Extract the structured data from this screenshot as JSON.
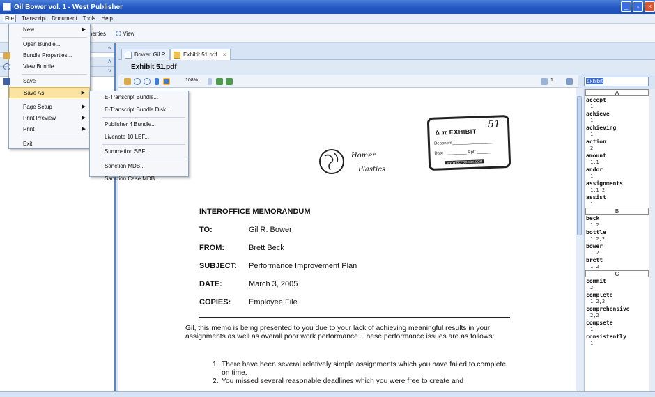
{
  "window": {
    "title": "Gil Bower vol. 1 - West Publisher"
  },
  "menubar": [
    "File",
    "Transcript",
    "Document",
    "Tools",
    "Help"
  ],
  "app_toolbar": {
    "properties_label": "perties",
    "view_label": "View"
  },
  "file_menu": {
    "items": [
      {
        "label": "New",
        "submenu": true
      },
      {
        "label": "Open Bundle..."
      },
      {
        "label": "Bundle Properties..."
      },
      {
        "label": "View Bundle"
      },
      {
        "label": "Save"
      },
      {
        "label": "Save As",
        "submenu": true,
        "highlighted": true
      },
      {
        "label": "Page Setup",
        "submenu": true
      },
      {
        "label": "Print Preview",
        "submenu": true
      },
      {
        "label": "Print",
        "submenu": true
      },
      {
        "label": "Exit"
      }
    ]
  },
  "save_as_submenu": [
    "E-Transcript Bundle...",
    "E-Transcript Bundle Disk...",
    "Publisher 4 Bundle...",
    "Livenote 10 LEF...",
    "Summation SBF...",
    "Sanction MDB...",
    "Sanction Case MDB..."
  ],
  "tabs": [
    {
      "label": "Bower, Gil R"
    },
    {
      "label": "Exhibit 51.pdf",
      "close": "×"
    }
  ],
  "doc_header": "Exhibit 51.pdf",
  "doc_toolbar": {
    "zoom": "108%",
    "page": "1"
  },
  "document": {
    "logo_text_1": "Homer",
    "logo_text_2": "Plastics",
    "stamp": {
      "label": "Δ π EXHIBIT",
      "number": "51",
      "deponent": "Deponent",
      "date": "Date",
      "rptr": "Rptr.",
      "web": "WWW.DEPOBOOK.COM"
    },
    "title": "INTEROFFICE MEMORANDUM",
    "fields": [
      {
        "label": "TO:",
        "value": "Gil R. Bower"
      },
      {
        "label": "FROM:",
        "value": "Brett Beck"
      },
      {
        "label": "SUBJECT:",
        "value": "Performance Improvement Plan"
      },
      {
        "label": "DATE:",
        "value": "March 3, 2005"
      },
      {
        "label": "COPIES:",
        "value": "Employee File"
      }
    ],
    "body": "Gil, this memo is being presented to you due to your lack of achieving meaningful results in your assignments as well as overall poor work performance.  These performance issues are as follows:",
    "list": [
      {
        "n": "1.",
        "text": "There have been several relatively simple assignments which you have failed to complete on time."
      },
      {
        "n": "2.",
        "text": "You missed several reasonable deadlines which you were free to create and"
      }
    ]
  },
  "search": {
    "value": "exhibit"
  },
  "word_index": [
    {
      "letter": "A"
    },
    {
      "term": "accept",
      "pages": "1"
    },
    {
      "term": "achieve",
      "pages": "1"
    },
    {
      "term": "achieving",
      "pages": "1"
    },
    {
      "term": "action",
      "pages": "2"
    },
    {
      "term": "amount",
      "pages": "1,1"
    },
    {
      "term": "andor",
      "pages": "1"
    },
    {
      "term": "assignments",
      "pages": "1,1 2"
    },
    {
      "term": "assist",
      "pages": "1"
    },
    {
      "letter": "B"
    },
    {
      "term": "beck",
      "pages": "1 2"
    },
    {
      "term": "bottle",
      "pages": "1 2,2"
    },
    {
      "term": "bower",
      "pages": "1 2"
    },
    {
      "term": "brett",
      "pages": "1 2"
    },
    {
      "letter": "C"
    },
    {
      "term": "commit",
      "pages": "2"
    },
    {
      "term": "complete",
      "pages": "1 2,2"
    },
    {
      "term": "comprehensive",
      "pages": "2,2"
    },
    {
      "term": "compsete",
      "pages": "1"
    },
    {
      "term": "consistently",
      "pages": "1"
    }
  ]
}
